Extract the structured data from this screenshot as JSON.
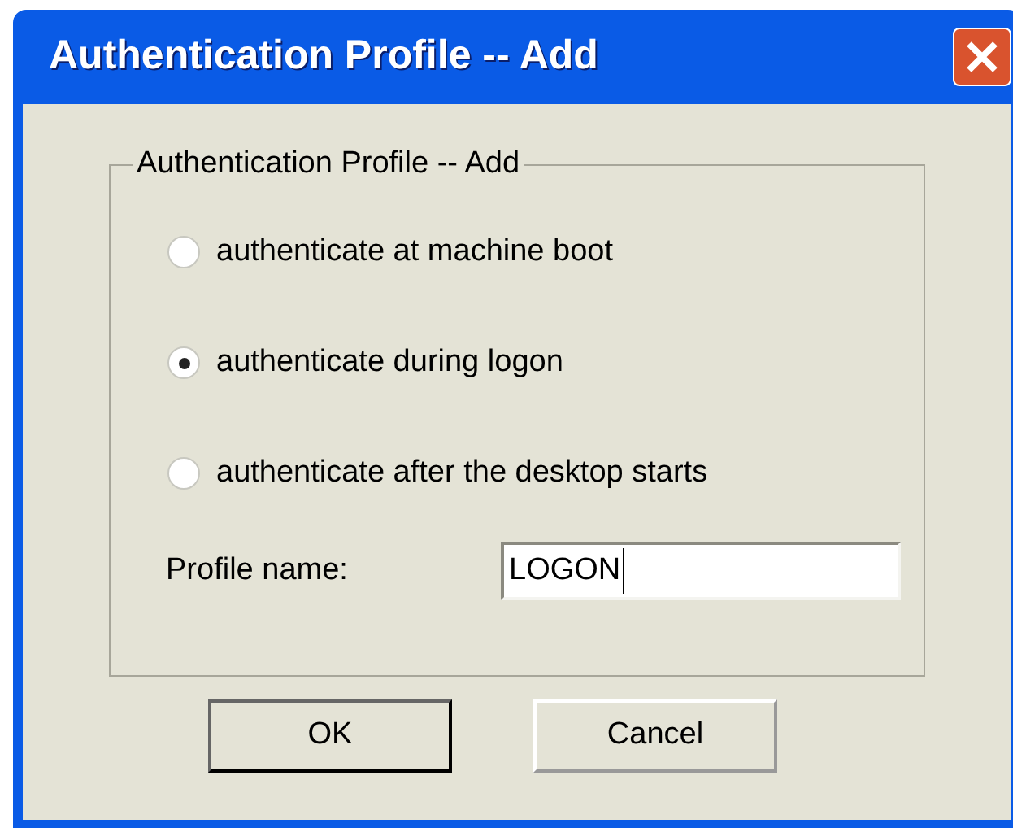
{
  "window": {
    "title": "Authentication Profile -- Add"
  },
  "group": {
    "legend": "Authentication Profile -- Add"
  },
  "options": [
    {
      "label": "authenticate at machine boot",
      "selected": false
    },
    {
      "label": "authenticate during logon",
      "selected": true
    },
    {
      "label": "authenticate after the desktop starts",
      "selected": false
    }
  ],
  "profile_name": {
    "label": "Profile name:",
    "value": "LOGON"
  },
  "buttons": [
    {
      "label": "OK",
      "default": true
    },
    {
      "label": "Cancel",
      "default": false
    }
  ]
}
